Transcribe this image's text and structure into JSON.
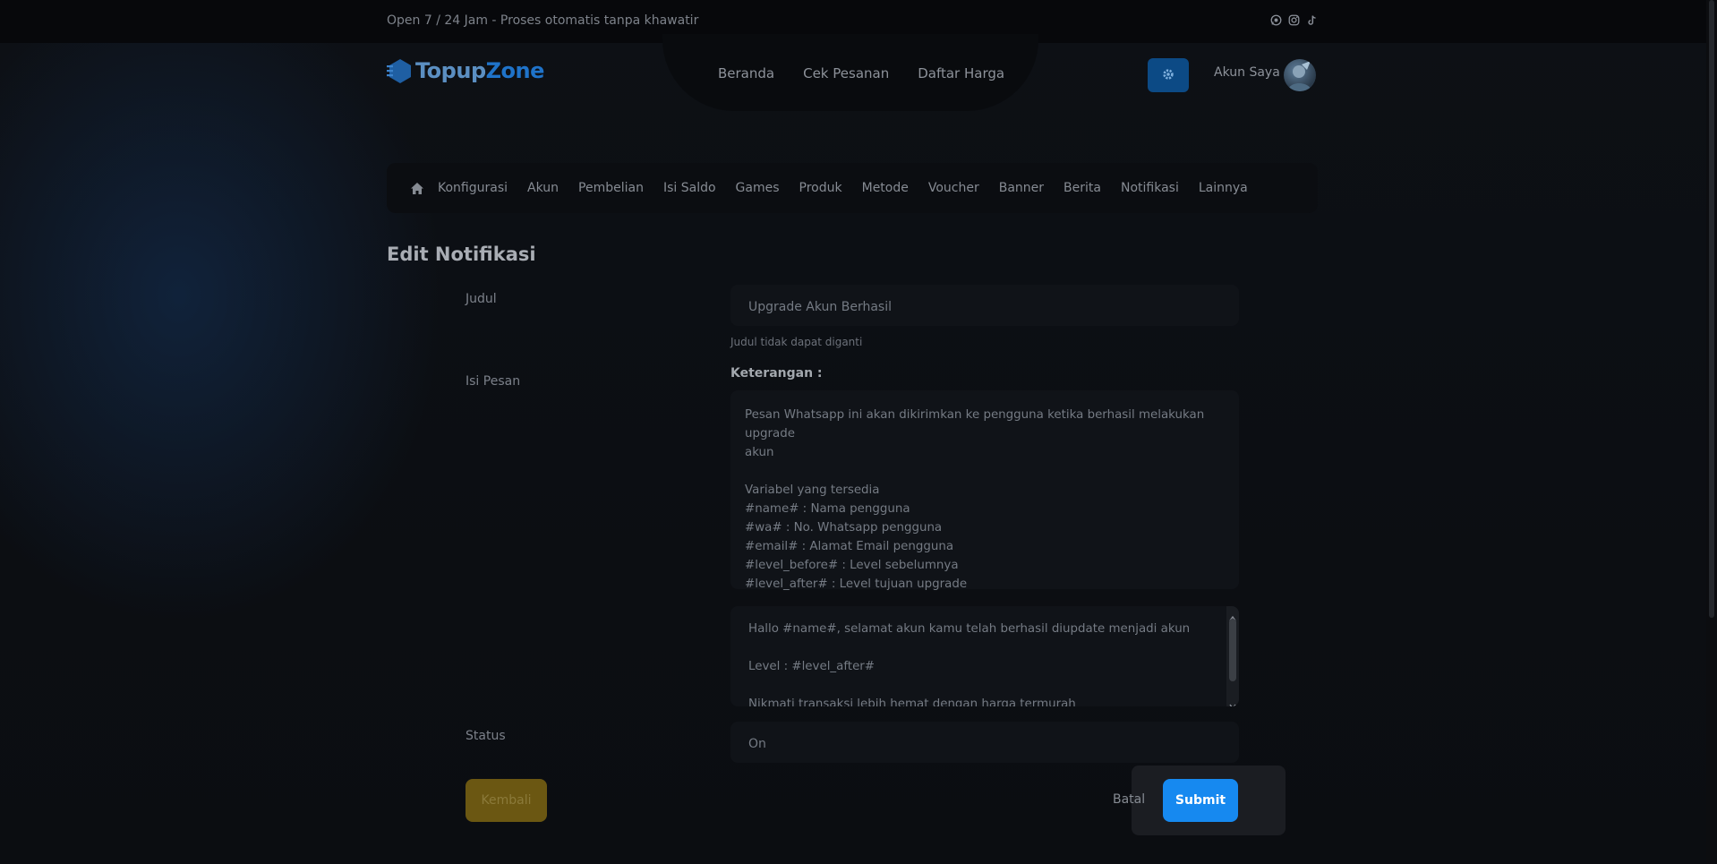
{
  "topbar": {
    "text": "Open 7 / 24 Jam - Proses otomatis tanpa khawatir",
    "social": [
      "whatsapp-icon",
      "instagram-icon",
      "tiktok-icon"
    ]
  },
  "brand": {
    "part1": "Topup",
    "part2": "Zone"
  },
  "mainnav": [
    "Beranda",
    "Cek Pesanan",
    "Daftar Harga"
  ],
  "account": {
    "label": "Akun Saya"
  },
  "admin_nav": {
    "home_icon": "home-icon",
    "items": [
      "Konfigurasi",
      "Akun",
      "Pembelian",
      "Isi Saldo",
      "Games",
      "Produk",
      "Metode",
      "Voucher",
      "Banner",
      "Berita",
      "Notifikasi",
      "Lainnya"
    ]
  },
  "page": {
    "title": "Edit Notifikasi"
  },
  "form": {
    "judul_label": "Judul",
    "judul_value": "Upgrade Akun Berhasil",
    "judul_hint": "Judul tidak dapat diganti",
    "isi_label": "Isi Pesan",
    "keterangan_label": "Keterangan :",
    "keterangan_lines": [
      "Pesan Whatsapp ini akan dikirimkan ke pengguna ketika berhasil melakukan upgrade",
      "akun",
      "",
      "Variabel yang tersedia",
      "#name# : Nama pengguna",
      "#wa# : No. Whatsapp pengguna",
      "#email# : Alamat Email pengguna",
      "#level_before# : Level sebelumnya",
      "#level_after# : Level tujuan upgrade"
    ],
    "message_lines": [
      "Hallo #name#, selamat akun kamu telah berhasil diupdate menjadi akun",
      "",
      "Level : #level_after#",
      "",
      "Nikmati transaksi lebih hemat dengan harga termurah"
    ],
    "status_label": "Status",
    "status_value": "On"
  },
  "buttons": {
    "back": "Kembali",
    "cancel": "Batal",
    "submit": "Submit"
  },
  "colors": {
    "accent": "#1689f0",
    "back_button": "#6b5712",
    "gear_button": "#0c4a85"
  }
}
